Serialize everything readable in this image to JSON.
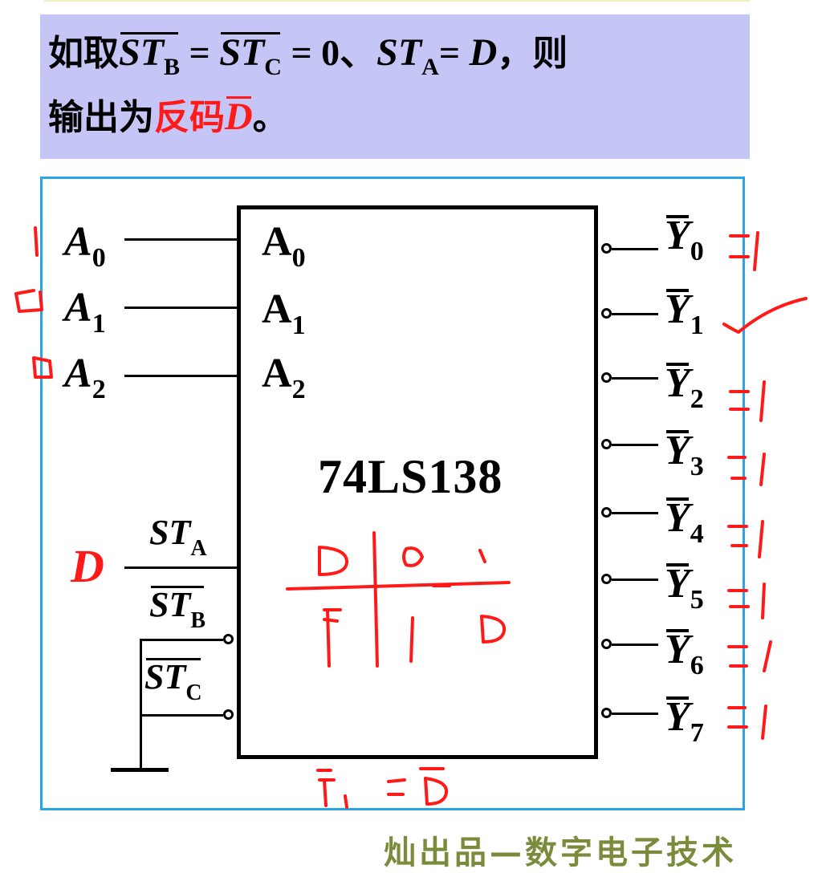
{
  "caption": {
    "line1": {
      "prefix": "如取",
      "st": "ST",
      "sub_b": "B",
      "eq1": " = ",
      "sub_c": "C",
      "eq2": " = 0、",
      "sub_a": "A",
      "eq3": "= ",
      "d": "D",
      "suffix": "，则"
    },
    "line2": {
      "prefix": "输出为",
      "highlight": "反码",
      "d": "D",
      "suffix": "。"
    },
    "background_color": "#c6c6f6",
    "highlight_color": "#ff1a1a"
  },
  "chip": {
    "name": "74LS138",
    "inputs": [
      {
        "letter": "A",
        "sub": "0"
      },
      {
        "letter": "A",
        "sub": "1"
      },
      {
        "letter": "A",
        "sub": "2"
      }
    ],
    "enables": {
      "st": "ST",
      "a": "A",
      "b": "B",
      "c": "C"
    },
    "outputs": [
      {
        "letter": "Y",
        "sub": "0"
      },
      {
        "letter": "Y",
        "sub": "1"
      },
      {
        "letter": "Y",
        "sub": "2"
      },
      {
        "letter": "Y",
        "sub": "3"
      },
      {
        "letter": "Y",
        "sub": "4"
      },
      {
        "letter": "Y",
        "sub": "5"
      },
      {
        "letter": "Y",
        "sub": "6"
      },
      {
        "letter": "Y",
        "sub": "7"
      }
    ]
  },
  "external_labels": {
    "inputs": [
      {
        "letter": "A",
        "sub": "0"
      },
      {
        "letter": "A",
        "sub": "1"
      },
      {
        "letter": "A",
        "sub": "2"
      }
    ],
    "data": "D"
  },
  "handwriting": {
    "input_values": [
      "1",
      "0",
      "0"
    ],
    "output_values": [
      "1",
      "",
      "1",
      "1",
      "1",
      "1",
      "1",
      "1"
    ],
    "table_header": [
      "D",
      "0",
      "1"
    ],
    "table_row": [
      "Y1",
      "1",
      "0"
    ],
    "result": "Y1 = D",
    "ink_color": "#ff1a1a"
  },
  "watermark": "灿出品—数字电子技术",
  "frame_color": "#29a4e6"
}
